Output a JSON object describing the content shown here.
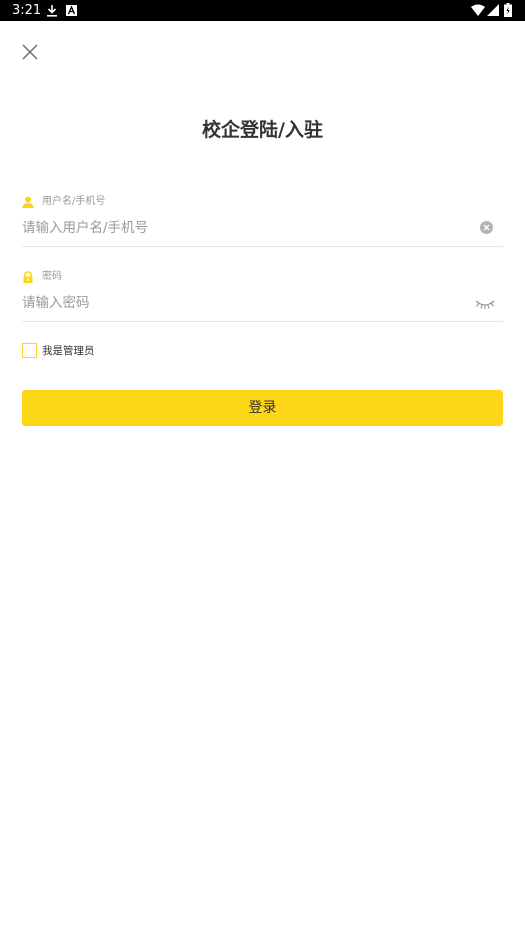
{
  "status_bar": {
    "time": "3:21",
    "icons": [
      "download-icon",
      "a-icon",
      "wifi-icon",
      "signal-icon",
      "battery-icon"
    ]
  },
  "header": {
    "close_icon": "close-icon",
    "title": "校企登陆/入驻"
  },
  "form": {
    "username": {
      "label": "用户名/手机号",
      "placeholder": "请输入用户名/手机号",
      "value": "",
      "icon": "user-icon",
      "clear_icon": "clear-icon"
    },
    "password": {
      "label": "密码",
      "placeholder": "请输入密码",
      "value": "",
      "icon": "lock-icon",
      "toggle_icon": "eye-closed-icon"
    },
    "admin": {
      "label": "我是管理员",
      "checked": false
    },
    "login_label": "登录"
  },
  "colors": {
    "accent": "#fdd618",
    "title_text": "#333333",
    "placeholder_text": "#999999",
    "divider": "#e6e6e6"
  }
}
